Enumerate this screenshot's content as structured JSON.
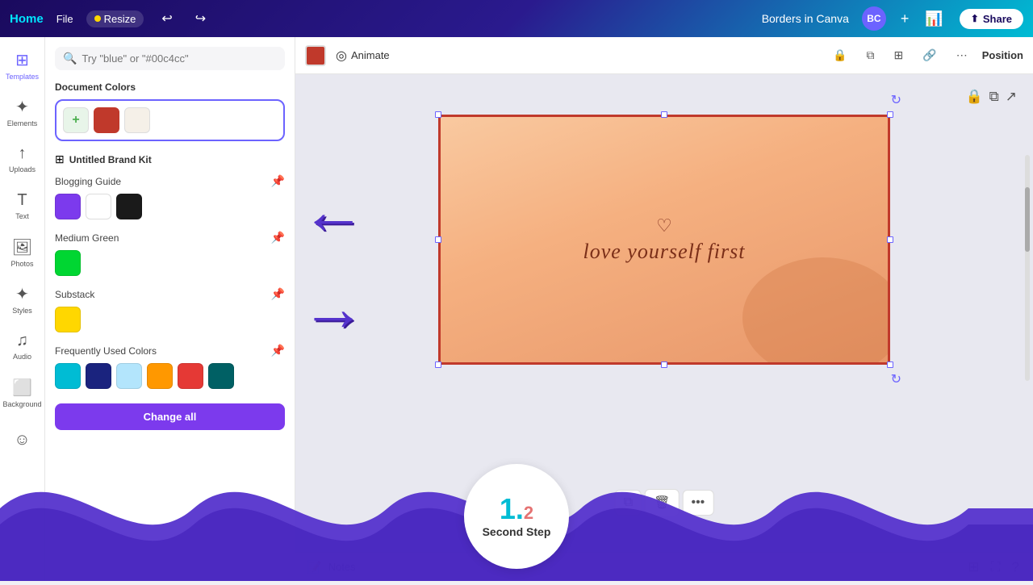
{
  "topbar": {
    "home_label": "Home",
    "file_label": "File",
    "resize_label": "Resize",
    "title": "Borders in Canva",
    "avatar_text": "BC",
    "share_label": "Share",
    "undo_icon": "↩",
    "redo_icon": "↪"
  },
  "sidebar": {
    "items": [
      {
        "label": "Templates",
        "icon": "⊞"
      },
      {
        "label": "Elements",
        "icon": "✦"
      },
      {
        "label": "Uploads",
        "icon": "↑"
      },
      {
        "label": "Text",
        "icon": "T"
      },
      {
        "label": "Photos",
        "icon": "🖼"
      },
      {
        "label": "Styles",
        "icon": "✦"
      },
      {
        "label": "Audio",
        "icon": "♫"
      },
      {
        "label": "Background",
        "icon": "⬜"
      },
      {
        "label": "",
        "icon": "☺"
      }
    ]
  },
  "color_panel": {
    "search_placeholder": "Try \"blue\" or \"#00c4cc\"",
    "document_colors_title": "Document Colors",
    "brand_kit_title": "Untitled Brand Kit",
    "blogging_guide_title": "Blogging Guide",
    "medium_green_title": "Medium Green",
    "substack_title": "Substack",
    "frequently_used_title": "Frequently Used Colors",
    "change_all_label": "Change all"
  },
  "toolbar": {
    "animate_label": "Animate",
    "position_label": "Position"
  },
  "canvas": {
    "script_text": "love yourself first",
    "heart_char": "♡"
  },
  "canvas_actions": {
    "copy_icon": "⧉",
    "trash_icon": "🗑",
    "more_icon": "•••"
  },
  "notes": {
    "label": "Notes"
  },
  "step": {
    "number": "1.2",
    "number_main": "1.",
    "number_sub": "2",
    "label": "Second Step"
  }
}
